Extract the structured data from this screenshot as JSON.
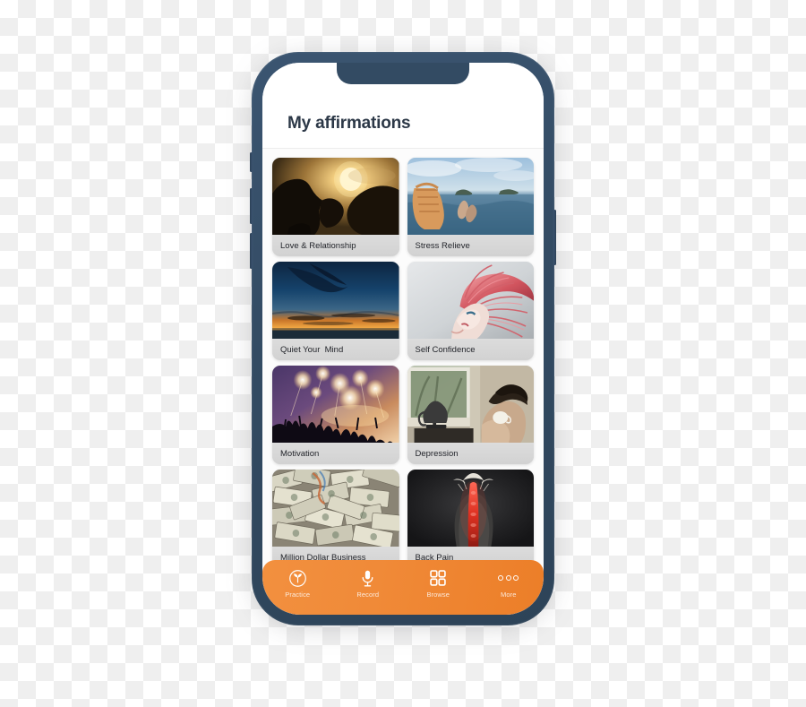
{
  "app": {
    "header": {
      "title": "My affirmations"
    },
    "cards": [
      {
        "label": "Love & Relationship",
        "image_name": "couple-silhouette-sunset-kiss"
      },
      {
        "label": "Stress Relieve",
        "image_name": "ocean-islands-feet-basket"
      },
      {
        "label": "Quiet Your  Mind",
        "image_name": "sunset-sky-clouds-horizon"
      },
      {
        "label": "Self Confidence",
        "image_name": "woman-pink-hair-wind"
      },
      {
        "label": "Motivation",
        "image_name": "concert-crowd-stage-lights"
      },
      {
        "label": "Depression",
        "image_name": "person-curled-by-window"
      },
      {
        "label": "Million Dollar Business",
        "image_name": "pile-of-dollar-bills"
      },
      {
        "label": "Back Pain",
        "image_name": "dark-back-red-spine"
      }
    ],
    "bottom_nav": {
      "items": [
        {
          "label": "Practice",
          "icon": "sprout-circle-icon"
        },
        {
          "label": "Record",
          "icon": "microphone-icon"
        },
        {
          "label": "Browse",
          "icon": "grid-2x2-icon"
        },
        {
          "label": "More",
          "icon": "three-dots-icon"
        }
      ]
    }
  },
  "colors": {
    "frame": "#334B63",
    "accent_orange_light": "#F2903F",
    "accent_orange_dark": "#EC7E28",
    "title_text": "#2C3847",
    "label_bar": "#D6D6D6"
  }
}
